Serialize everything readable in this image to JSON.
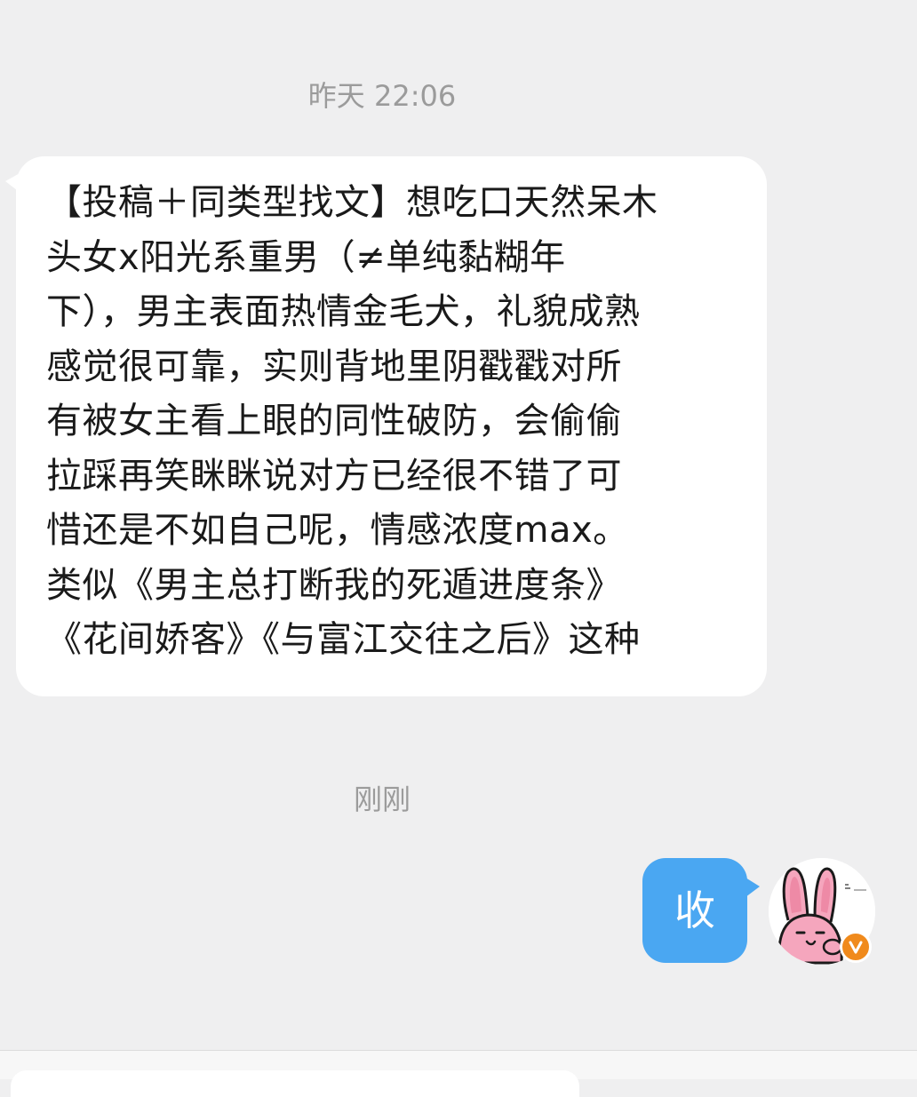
{
  "chat": {
    "timestamp_1": "昨天 22:06",
    "incoming_message": "【投稿＋同类型找文】想吃口天然呆木\n头女x阳光系重男（≠单纯黏糊年\n下），男主表面热情金毛犬，礼貌成熟\n感觉很可靠，实则背地里阴戳戳对所\n有被女主看上眼的同性破防，会偷偷\n拉踩再笑眯眯说对方已经很不错了可\n惜还是不如自己呢，情感浓度max。\n类似《男主总打断我的死遁进度条》\n《花间娇客》《与富江交往之后》这种",
    "timestamp_2": "刚刚",
    "outgoing_message": "收"
  },
  "avatar": {
    "icon": "pink-bunny-avatar",
    "badge_icon": "verified-v-icon",
    "badge_color": "#f08a1c"
  },
  "colors": {
    "background": "#efeff0",
    "incoming_bubble": "#ffffff",
    "outgoing_bubble": "#4aa7f2",
    "timestamp_text": "#9b9b9b"
  }
}
